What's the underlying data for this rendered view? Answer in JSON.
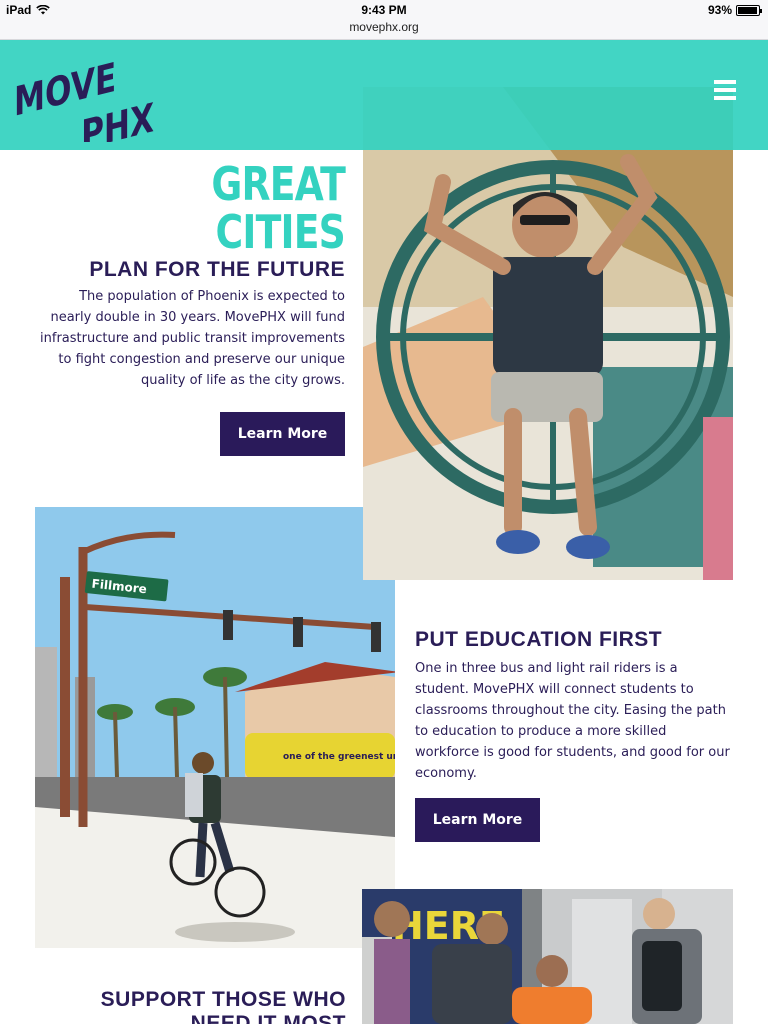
{
  "status_bar": {
    "device": "iPad",
    "time": "9:43 PM",
    "url": "movephx.org",
    "battery": "93%",
    "battery_level": 0.93
  },
  "header": {
    "logo_line1": "MOVE",
    "logo_line2": "PHX",
    "menu_icon": "hamburger-icon",
    "bg_color": "#34d2c0"
  },
  "section1": {
    "title": "GREAT CITIES",
    "subtitle": "PLAN FOR THE FUTURE",
    "body": "The population of Phoenix is expected to nearly double in 30 years. MovePHX will fund infrastructure and public transit improvements to fight congestion and preserve our unique quality of life as the city grows.",
    "button_label": "Learn More"
  },
  "section2": {
    "subtitle": "PUT EDUCATION FIRST",
    "body": "One in three bus and light rail riders is a student. MovePHX will connect students to classrooms throughout the city. Easing the path to education to produce a more skilled workforce is good for students, and good for our economy.",
    "button_label": "Learn More",
    "street_sign": "Fillmore",
    "bus_text": "one of the greenest universities in the nation"
  },
  "section3": {
    "subtitle_line1": "SUPPORT THOSE WHO",
    "subtitle_line2": "NEED IT MOST",
    "train_text": "HERE"
  },
  "colors": {
    "accent": "#34d2c0",
    "brand_dark": "#2a1d57",
    "button": "#2a1a5a"
  }
}
